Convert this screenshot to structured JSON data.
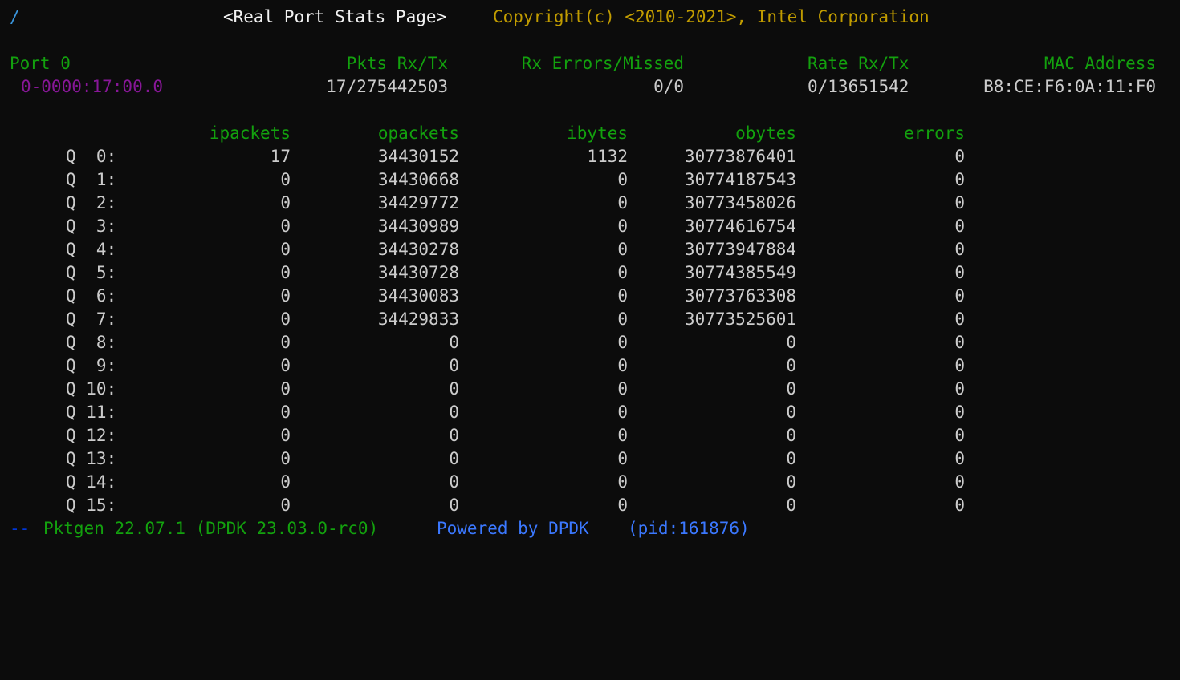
{
  "title_line": {
    "prompt": "/",
    "page_title": "<Real Port Stats Page>",
    "copyright": "Copyright(c) <2010-2021>, Intel Corporation"
  },
  "port_header": {
    "port": "Port 0",
    "pkts_rx_tx": "Pkts Rx/Tx",
    "rx_errors_missed": "Rx Errors/Missed",
    "rate_rx_tx": "Rate Rx/Tx",
    "mac_address": "MAC Address"
  },
  "port_values": {
    "pci_id": "0-0000:17:00.0",
    "pkts": "17/275442503",
    "errors": "0/0",
    "rate": "0/13651542",
    "mac": "B8:CE:F6:0A:11:F0"
  },
  "queue_table": {
    "columns": [
      "ipackets",
      "opackets",
      "ibytes",
      "obytes",
      "errors"
    ],
    "rows": [
      {
        "queue": "Q  0:",
        "ipackets": "17",
        "opackets": "34430152",
        "ibytes": "1132",
        "obytes": "30773876401",
        "errors": "0"
      },
      {
        "queue": "Q  1:",
        "ipackets": "0",
        "opackets": "34430668",
        "ibytes": "0",
        "obytes": "30774187543",
        "errors": "0"
      },
      {
        "queue": "Q  2:",
        "ipackets": "0",
        "opackets": "34429772",
        "ibytes": "0",
        "obytes": "30773458026",
        "errors": "0"
      },
      {
        "queue": "Q  3:",
        "ipackets": "0",
        "opackets": "34430989",
        "ibytes": "0",
        "obytes": "30774616754",
        "errors": "0"
      },
      {
        "queue": "Q  4:",
        "ipackets": "0",
        "opackets": "34430278",
        "ibytes": "0",
        "obytes": "30773947884",
        "errors": "0"
      },
      {
        "queue": "Q  5:",
        "ipackets": "0",
        "opackets": "34430728",
        "ibytes": "0",
        "obytes": "30774385549",
        "errors": "0"
      },
      {
        "queue": "Q  6:",
        "ipackets": "0",
        "opackets": "34430083",
        "ibytes": "0",
        "obytes": "30773763308",
        "errors": "0"
      },
      {
        "queue": "Q  7:",
        "ipackets": "0",
        "opackets": "34429833",
        "ibytes": "0",
        "obytes": "30773525601",
        "errors": "0"
      },
      {
        "queue": "Q  8:",
        "ipackets": "0",
        "opackets": "0",
        "ibytes": "0",
        "obytes": "0",
        "errors": "0"
      },
      {
        "queue": "Q  9:",
        "ipackets": "0",
        "opackets": "0",
        "ibytes": "0",
        "obytes": "0",
        "errors": "0"
      },
      {
        "queue": "Q 10:",
        "ipackets": "0",
        "opackets": "0",
        "ibytes": "0",
        "obytes": "0",
        "errors": "0"
      },
      {
        "queue": "Q 11:",
        "ipackets": "0",
        "opackets": "0",
        "ibytes": "0",
        "obytes": "0",
        "errors": "0"
      },
      {
        "queue": "Q 12:",
        "ipackets": "0",
        "opackets": "0",
        "ibytes": "0",
        "obytes": "0",
        "errors": "0"
      },
      {
        "queue": "Q 13:",
        "ipackets": "0",
        "opackets": "0",
        "ibytes": "0",
        "obytes": "0",
        "errors": "0"
      },
      {
        "queue": "Q 14:",
        "ipackets": "0",
        "opackets": "0",
        "ibytes": "0",
        "obytes": "0",
        "errors": "0"
      },
      {
        "queue": "Q 15:",
        "ipackets": "0",
        "opackets": "0",
        "ibytes": "0",
        "obytes": "0",
        "errors": "0"
      }
    ]
  },
  "footer": {
    "dashes": "--",
    "version": "Pktgen 22.07.1 (DPDK 23.03.0-rc0)",
    "powered": "Powered by DPDK",
    "pid": "(pid:161876)"
  },
  "colors": {
    "background": "#0c0c0c",
    "green": "#13a10e",
    "yellow": "#c19c00",
    "magenta": "#881798",
    "blue": "#3b78ff",
    "cyan": "#3a96dd",
    "text": "#cccccc"
  }
}
